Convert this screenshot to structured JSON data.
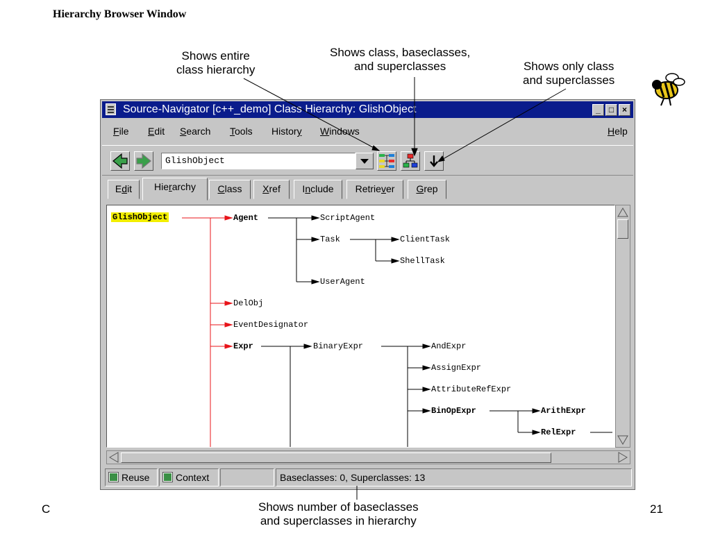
{
  "slide": {
    "title": "Hierarchy Browser Window",
    "footer_left": "C",
    "footer_right": "21",
    "callouts": {
      "entire_hierarchy": [
        "Shows entire",
        "class hierarchy"
      ],
      "base_super": [
        "Shows class, baseclasses,",
        "and superclasses"
      ],
      "only_super": [
        "Shows only class",
        "and superclasses"
      ],
      "count": [
        "Shows number of baseclasses",
        "and superclasses in hierarchy"
      ]
    }
  },
  "window": {
    "title": "Source-Navigator [c++_demo] Class Hierarchy: GlishObject",
    "controls": {
      "minimize": "_",
      "maximize": "□",
      "close": "×"
    }
  },
  "menubar": {
    "items": [
      {
        "pre": "",
        "u": "F",
        "post": "ile"
      },
      {
        "pre": "",
        "u": "E",
        "post": "dit"
      },
      {
        "pre": "",
        "u": "S",
        "post": "earch"
      },
      {
        "pre": "",
        "u": "T",
        "post": "ools"
      },
      {
        "pre": "Histor",
        "u": "y",
        "post": ""
      },
      {
        "pre": "",
        "u": "W",
        "post": "indows"
      }
    ],
    "help": {
      "pre": "",
      "u": "H",
      "post": "elp"
    }
  },
  "toolbar": {
    "back_icon": "back-arrow-icon",
    "forward_icon": "forward-arrow-icon",
    "symbol_value": "GlishObject",
    "full_hierarchy_icon": "entire-hierarchy-icon",
    "base_super_icon": "base-super-classes-icon",
    "super_only_icon": "down-arrow-icon"
  },
  "tabs": [
    {
      "pre": "E",
      "u": "d",
      "post": "it"
    },
    {
      "pre": "Hie",
      "u": "r",
      "post": "archy"
    },
    {
      "pre": "",
      "u": "C",
      "post": "lass"
    },
    {
      "pre": "",
      "u": "X",
      "post": "ref"
    },
    {
      "pre": "I",
      "u": "n",
      "post": "clude"
    },
    {
      "pre": "Retrie",
      "u": "v",
      "post": "er"
    },
    {
      "pre": "",
      "u": "G",
      "post": "rep"
    }
  ],
  "hierarchy": {
    "root": "GlishObject",
    "nodes": {
      "agent": "Agent",
      "script_agent": "ScriptAgent",
      "task": "Task",
      "client_task": "ClientTask",
      "shell_task": "ShellTask",
      "user_agent": "UserAgent",
      "del_obj": "DelObj",
      "event_designator": "EventDesignator",
      "expr": "Expr",
      "binary_expr": "BinaryExpr",
      "and_expr": "AndExpr",
      "assign_expr": "AssignExpr",
      "attribute_ref_expr": "AttributeRefExpr",
      "bin_op_expr": "BinOpExpr",
      "arith_expr": "ArithExpr",
      "rel_expr": "RelExpr"
    },
    "colors": {
      "root_link": "#e8141a",
      "link": "#000000",
      "selection": "#f2ee00"
    }
  },
  "statusbar": {
    "reuse": "Reuse",
    "context": "Context",
    "message": "Baseclasses: 0, Superclasses: 13"
  }
}
